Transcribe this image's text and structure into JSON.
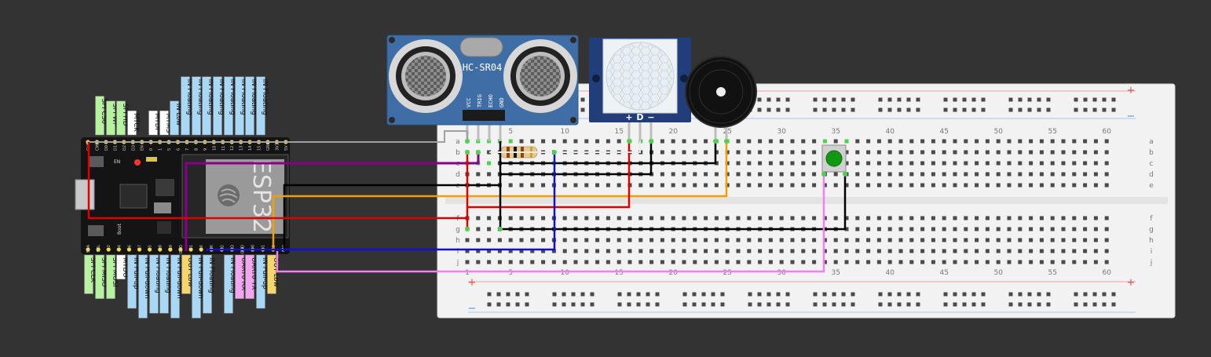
{
  "board": {
    "chip_label": "ESP32",
    "en_label": "EN",
    "boot_label": "Boot"
  },
  "sensor": {
    "name": "HC-SR04",
    "pins": [
      "VCC",
      "TRIG",
      "ECHO",
      "GND"
    ]
  },
  "pir": {
    "pins": [
      "+",
      "D",
      "−"
    ]
  },
  "breadboard": {
    "columns": [
      "1",
      "5",
      "10",
      "15",
      "20",
      "25",
      "30",
      "35",
      "40",
      "45",
      "50",
      "55",
      "60"
    ],
    "rows_top": [
      "a",
      "b",
      "c",
      "d",
      "e"
    ],
    "rows_bottom": [
      "f",
      "g",
      "h",
      "i",
      "j"
    ],
    "rail_plus": "+",
    "rail_minus": "−"
  },
  "header_top": [
    "CLK",
    "CMD",
    "D0",
    "D1",
    "D2",
    "D3",
    "EN",
    "0",
    "1",
    "5",
    "6",
    "7",
    "8",
    "9",
    "10",
    "11",
    "12",
    "13",
    "14",
    "15",
    "GND",
    "3V3",
    "5V"
  ],
  "header_bottom": [
    "SDA",
    "SCL",
    "2",
    "4",
    "16",
    "17",
    "5",
    "18",
    "19",
    "GND",
    "21",
    "RX",
    "TX",
    "22",
    "23",
    "GND",
    "0",
    "1",
    "2",
    "3"
  ],
  "labels_top": [
    {
      "text": "SPI CS0",
      "kind": "green"
    },
    {
      "text": "SPI WP",
      "kind": "green"
    },
    {
      "text": "SPI HD",
      "kind": "green"
    },
    {
      "text": "MTCK",
      "kind": "white"
    },
    {
      "text": "MTDI",
      "kind": "white"
    },
    {
      "text": "MTMS",
      "kind": "white"
    },
    {
      "text": "IN Low",
      "kind": "blue"
    },
    {
      "text": "IN Floating",
      "kind": "blue"
    },
    {
      "text": "IN Floating",
      "kind": "blue"
    },
    {
      "text": "IN Floating",
      "kind": "blue"
    },
    {
      "text": "IN Floating",
      "kind": "blue"
    },
    {
      "text": "IN Floating",
      "kind": "blue"
    },
    {
      "text": "IN Floating",
      "kind": "blue"
    },
    {
      "text": "IN Floating",
      "kind": "blue"
    },
    {
      "text": "IN Floating",
      "kind": "blue"
    }
  ],
  "labels_bottom": [
    {
      "text": "SPI CLK",
      "kind": "green"
    },
    {
      "text": "SPI MISO",
      "kind": "green"
    },
    {
      "text": "SPI MOSI",
      "kind": "green"
    },
    {
      "text": "MTDO",
      "kind": "white"
    },
    {
      "text": "IN Pull-up",
      "kind": "blue"
    },
    {
      "text": "IN Pull-down",
      "kind": "blue"
    },
    {
      "text": "IN Floating",
      "kind": "blue"
    },
    {
      "text": "IN Floating",
      "kind": "blue"
    },
    {
      "text": "IN Pull-down",
      "kind": "blue"
    },
    {
      "text": "OUT Low",
      "kind": "yellow"
    },
    {
      "text": "IN Pull-down",
      "kind": "blue"
    },
    {
      "text": "IN Floating",
      "kind": "blue"
    },
    {
      "text": "IN Floating",
      "kind": "blue"
    },
    {
      "text": "UART0 RX",
      "kind": "pink"
    },
    {
      "text": "UART0 TX",
      "kind": "pink"
    },
    {
      "text": "IN Pull-up",
      "kind": "blue"
    },
    {
      "text": "OUT Low",
      "kind": "yellow"
    }
  ],
  "colors": {
    "background": "#333333",
    "board": "#141414",
    "breadboard": "#f2f2f2",
    "sensor_blue": "#3f6ea6",
    "label_green": "#b7f2a1",
    "label_blue": "#a8d8f5",
    "label_white": "#ffffff",
    "label_yellow": "#f7d56b",
    "label_pink": "#f3a6f0",
    "wire_red": "#e00000",
    "wire_black": "#000000",
    "wire_orange": "#f0a000",
    "wire_blue": "#1010d0",
    "wire_purple": "#8a008a",
    "wire_pink": "#ee82ee",
    "wire_gray": "#a0a0a0",
    "pin_green": "#4cd24c",
    "button_green": "#119911"
  },
  "wires": [
    {
      "name": "wire-gray",
      "color": "#a0a0a0"
    },
    {
      "name": "wire-purple",
      "color": "#8a008a"
    },
    {
      "name": "wire-black-gnd",
      "color": "#000000"
    },
    {
      "name": "wire-orange",
      "color": "#f0a000"
    },
    {
      "name": "wire-red-power",
      "color": "#e00000"
    },
    {
      "name": "wire-black-button",
      "color": "#000000"
    },
    {
      "name": "wire-blue",
      "color": "#1010d0"
    },
    {
      "name": "wire-pink",
      "color": "#ee82ee"
    }
  ]
}
